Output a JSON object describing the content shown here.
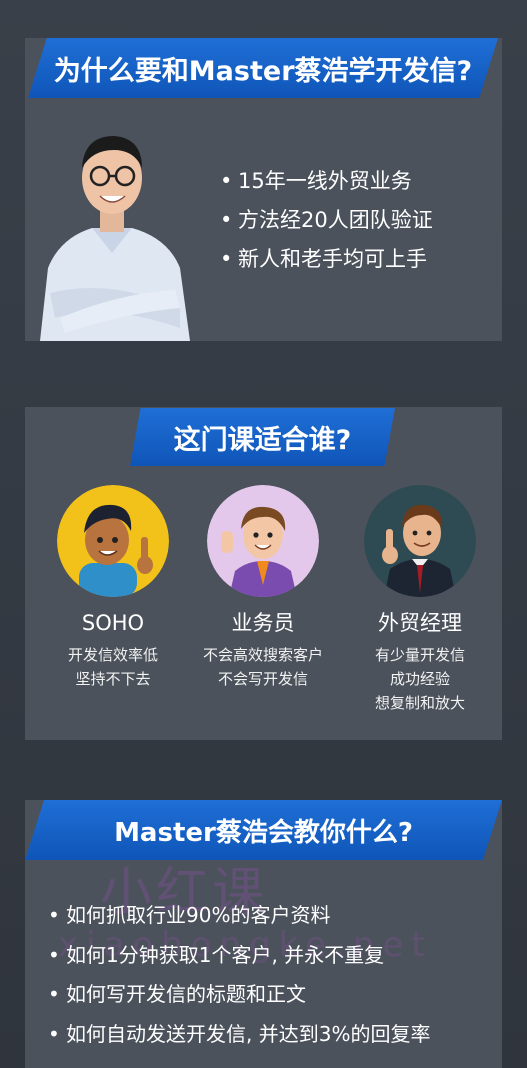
{
  "section1": {
    "title": "为什么要和Master蔡浩学开发信?",
    "bullets": [
      "15年一线外贸业务",
      "方法经20人团队验证",
      "新人和老手均可上手"
    ]
  },
  "section2": {
    "title": "这门课适合谁?",
    "personas": [
      {
        "role": "SOHO",
        "desc": [
          "开发信效率低",
          "坚持不下去"
        ]
      },
      {
        "role": "业务员",
        "desc": [
          "不会高效搜索客户",
          "不会写开发信"
        ]
      },
      {
        "role": "外贸经理",
        "desc": [
          "有少量开发信",
          "成功经验",
          "想复制和放大"
        ]
      }
    ]
  },
  "section3": {
    "title": "Master蔡浩会教你什么?",
    "items": [
      "如何抓取行业90%的客户资料",
      "如何1分钟获取1个客户, 并永不重复",
      "如何写开发信的标题和正文",
      "如何自动发送开发信, 并达到3%的回复率"
    ]
  },
  "watermark": {
    "cn": "小红课",
    "en": "xiaohongke.net"
  },
  "bullet_glyph": "•",
  "colors": {
    "banner": "#1565c8",
    "card": "#4b525c",
    "bg": "#363c45"
  }
}
